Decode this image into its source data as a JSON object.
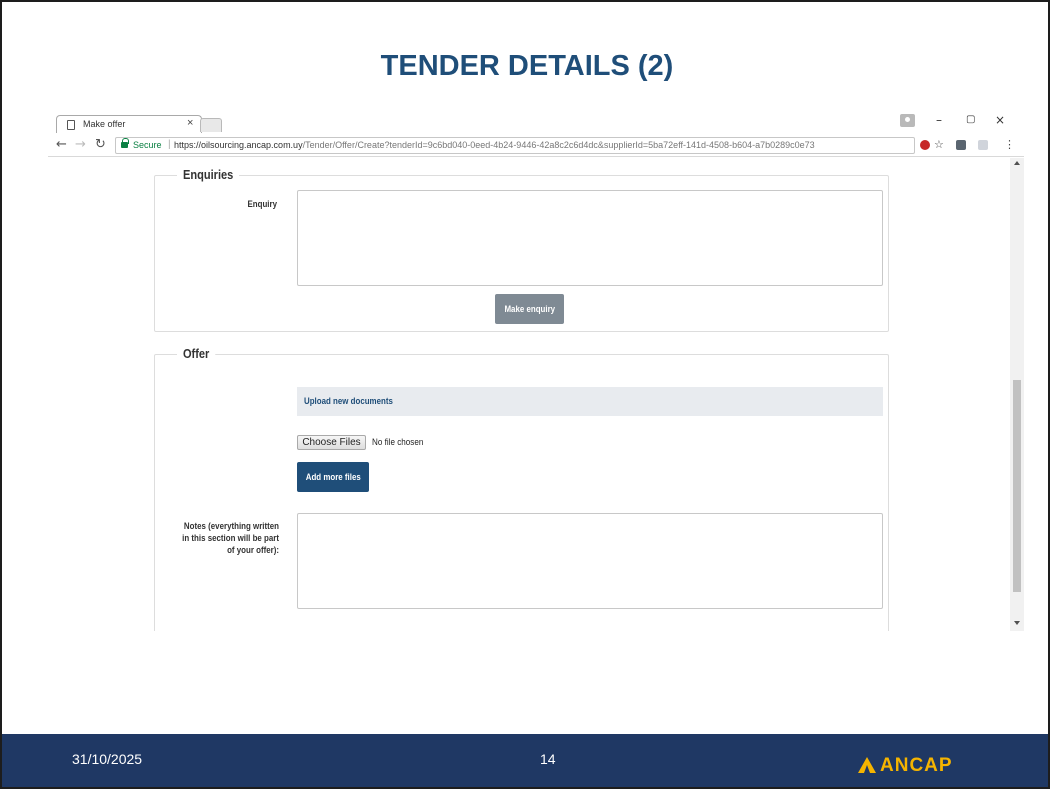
{
  "slide": {
    "title": "TENDER DETAILS (2)",
    "footer": {
      "date": "31/10/2025",
      "page_number": "14",
      "logo_text": "ANCAP",
      "logo_color": "#f5b400"
    }
  },
  "browser": {
    "tab_title": "Make offer",
    "secure_label": "Secure",
    "url_host": "https://oilsourcing.ancap.com.uy",
    "url_path": "/Tender/Offer/Create?tenderId=9c6bd040-0eed-4b24-9446-42a8c2c6d4dc&supplierId=5ba72eff-141d-4508-b604-a7b0289c0e73",
    "icons": [
      "page-icon",
      "close-icon",
      "profile-icon",
      "minimize-icon",
      "restore-icon",
      "close-window-icon",
      "back-icon",
      "forward-icon",
      "reload-icon",
      "lock-icon",
      "star-icon",
      "menu-icon"
    ]
  },
  "page": {
    "enquiries": {
      "legend": "Enquiries",
      "enquiry_label": "Enquiry",
      "enquiry_value": "",
      "button": "Make enquiry",
      "button_color": "#7f8a94"
    },
    "offer": {
      "legend": "Offer",
      "upload_header": "Upload new documents",
      "choose_files": "Choose Files",
      "no_file": "No file chosen",
      "add_files_button": "Add more files",
      "button_color": "#1f4e79",
      "notes_label_lines": [
        "Notes (everything written",
        "in this section will be part",
        "of your offer):"
      ],
      "notes_value": ""
    }
  },
  "colors": {
    "title": "#1f4e79",
    "footer_bg": "#1f3864",
    "secure_green": "#0b8043"
  }
}
